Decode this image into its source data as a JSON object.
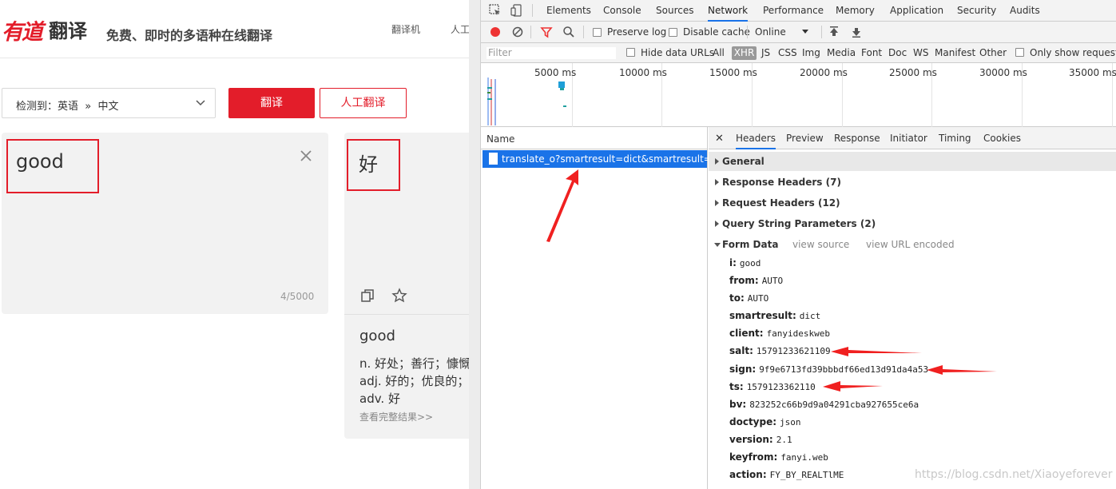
{
  "youdao": {
    "logo_mark": "有道",
    "logo_text": "翻译",
    "slogan": "免费、即时的多语种在线翻译",
    "nav": [
      "翻译机",
      "人工"
    ],
    "lang_select": "检测到：英语  »  中文",
    "translate_button": "翻译",
    "human_button": "人工翻译",
    "source_text": "good",
    "char_count": "4/5000",
    "result_text": "好",
    "dict": {
      "word": "good",
      "lines": [
        "n. 好处；善行；慷慨",
        "adj. 好的；优良的；",
        "adv. 好"
      ],
      "more": "查看完整结果>>"
    }
  },
  "devtools": {
    "tabs": [
      "Elements",
      "Console",
      "Sources",
      "Network",
      "Performance",
      "Memory",
      "Application",
      "Security",
      "Audits"
    ],
    "active_tab": "Network",
    "toolbar": {
      "preserve_log": "Preserve log",
      "disable_cache": "Disable cache",
      "throttle": "Online"
    },
    "filter": {
      "placeholder": "Filter",
      "hide_data_urls": "Hide data URLs",
      "types": [
        "All",
        "XHR",
        "JS",
        "CSS",
        "Img",
        "Media",
        "Font",
        "Doc",
        "WS",
        "Manifest",
        "Other"
      ],
      "active_type": "XHR",
      "only_show": "Only show requests"
    },
    "timeline_labels": [
      "5000 ms",
      "10000 ms",
      "15000 ms",
      "20000 ms",
      "25000 ms",
      "30000 ms",
      "35000 ms"
    ],
    "request_list": {
      "header": "Name",
      "selected": "translate_o?smartresult=dict&smartresult=rule"
    },
    "detail_tabs": [
      "Headers",
      "Preview",
      "Response",
      "Initiator",
      "Timing",
      "Cookies"
    ],
    "active_detail_tab": "Headers",
    "sections": {
      "general": "General",
      "response_headers": "Response Headers (7)",
      "request_headers": "Request Headers (12)",
      "query_params": "Query String Parameters (2)",
      "form_data": "Form Data",
      "view_source": "view source",
      "view_url_encoded": "view URL encoded"
    },
    "form_data": [
      {
        "key": "i:",
        "value": "good"
      },
      {
        "key": "from:",
        "value": "AUTO"
      },
      {
        "key": "to:",
        "value": "AUTO"
      },
      {
        "key": "smartresult:",
        "value": "dict"
      },
      {
        "key": "client:",
        "value": "fanyideskweb"
      },
      {
        "key": "salt:",
        "value": "15791233621109"
      },
      {
        "key": "sign:",
        "value": "9f9e6713fd39bbbdf66ed13d91da4a53"
      },
      {
        "key": "ts:",
        "value": "1579123362110"
      },
      {
        "key": "bv:",
        "value": "823252c66b9d9a04291cba927655ce6a"
      },
      {
        "key": "doctype:",
        "value": "json"
      },
      {
        "key": "version:",
        "value": "2.1"
      },
      {
        "key": "keyfrom:",
        "value": "fanyi.web"
      },
      {
        "key": "action:",
        "value": "FY_BY_REALTlME"
      }
    ]
  },
  "watermark": "https://blog.csdn.net/Xiaoyeforever",
  "colors": {
    "brand_red": "#e31d2a",
    "devtools_blue": "#1a73e8",
    "annotation_red": "#f02020"
  }
}
